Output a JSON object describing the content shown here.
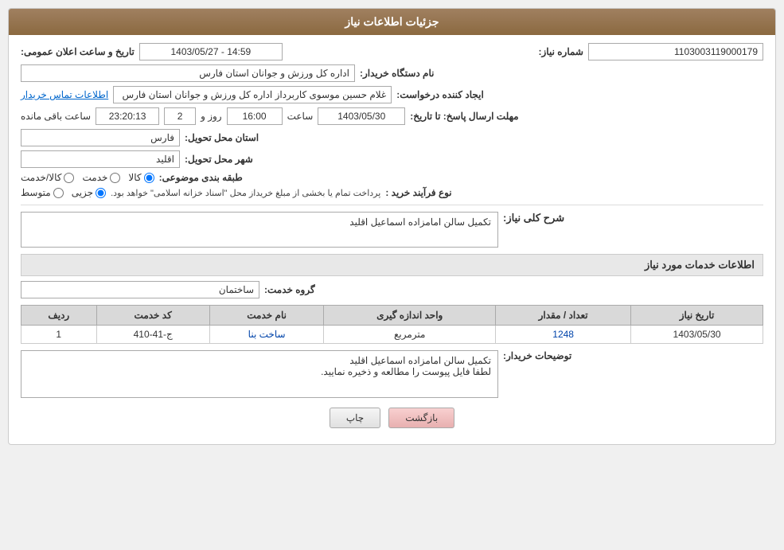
{
  "header": {
    "title": "جزئیات اطلاعات نیاز"
  },
  "fields": {
    "shmarehNiaz_label": "شماره نیاز:",
    "shmarehNiaz_value": "1103003119000179",
    "namdastgahKharidar_label": "نام دستگاه خریدار:",
    "namdastgahKharidar_value": "اداره کل ورزش و جوانان استان فارس",
    "tarikh_label": "تاریخ و ساعت اعلان عمومی:",
    "tarikh_value": "1403/05/27 - 14:59",
    "ijadKarandeh_label": "ایجاد کننده درخواست:",
    "ijadKarandeh_value": "غلام حسین موسوی کاربرداز اداره کل ورزش و جوانان استان فارس",
    "ettelaatTamas_text": "اطلاعات تماس خریدار",
    "mohlat_label": "مهلت ارسال پاسخ: تا تاریخ:",
    "mohlat_date": "1403/05/30",
    "mohlat_saat_label": "ساعت",
    "mohlat_saat_value": "16:00",
    "mohlat_rooz_label": "روز و",
    "mohlat_rooz_value": "2",
    "mohlat_saat2_value": "23:20:13",
    "mohlat_baqi_label": "ساعت باقی مانده",
    "ostan_label": "استان محل تحویل:",
    "ostan_value": "فارس",
    "shahr_label": "شهر محل تحویل:",
    "shahr_value": "اقلید",
    "tabaqehBandi_label": "طبقه بندی موضوعی:",
    "tabaqehBandi_kala": "کالا",
    "tabaqehBandi_khadamat": "خدمت",
    "tabaqehBandi_kalaKhadamat": "کالا/خدمت",
    "noweFarayand_label": "نوع فرآیند خرید :",
    "noweFarayand_jozee": "جزیی",
    "noweFarayand_motavaset": "متوسط",
    "noweFarayand_desc": "پرداخت تمام یا بخشی از مبلغ خریداز محل \"اسناد خزانه اسلامی\" خواهد بود.",
    "sharhKoli_label": "شرح کلی نیاز:",
    "sharhKoli_value": "تکمیل سالن امامزاده اسماعیل اقلید",
    "khadamatSection_label": "اطلاعات خدمات مورد نیاز",
    "gohreKhadamat_label": "گروه خدمت:",
    "gohreKhadamat_value": "ساختمان",
    "table": {
      "col_radif": "ردیف",
      "col_kodKhadamat": "کد خدمت",
      "col_namKhadamat": "نام خدمت",
      "col_vahadAndazegiri": "واحد اندازه گیری",
      "col_tedadMeqdar": "تعداد / مقدار",
      "col_tarikhNiaz": "تاریخ نیاز",
      "rows": [
        {
          "radif": "1",
          "kodKhadamat": "ج-41-410",
          "namKhadamat": "ساخت بنا",
          "vahadAndazegiri": "مترمربع",
          "tedadMeqdar": "1248",
          "tarikhNiaz": "1403/05/30"
        }
      ]
    },
    "tosihKharidar_label": "توضیحات خریدار:",
    "tosihKharidar_value": "تکمیل سالن امامزاده اسماعیل اقلید\nلطفا فایل پیوست را مطالعه و ذخیره نمایید.",
    "btn_back": "بازگشت",
    "btn_print": "چاپ"
  }
}
